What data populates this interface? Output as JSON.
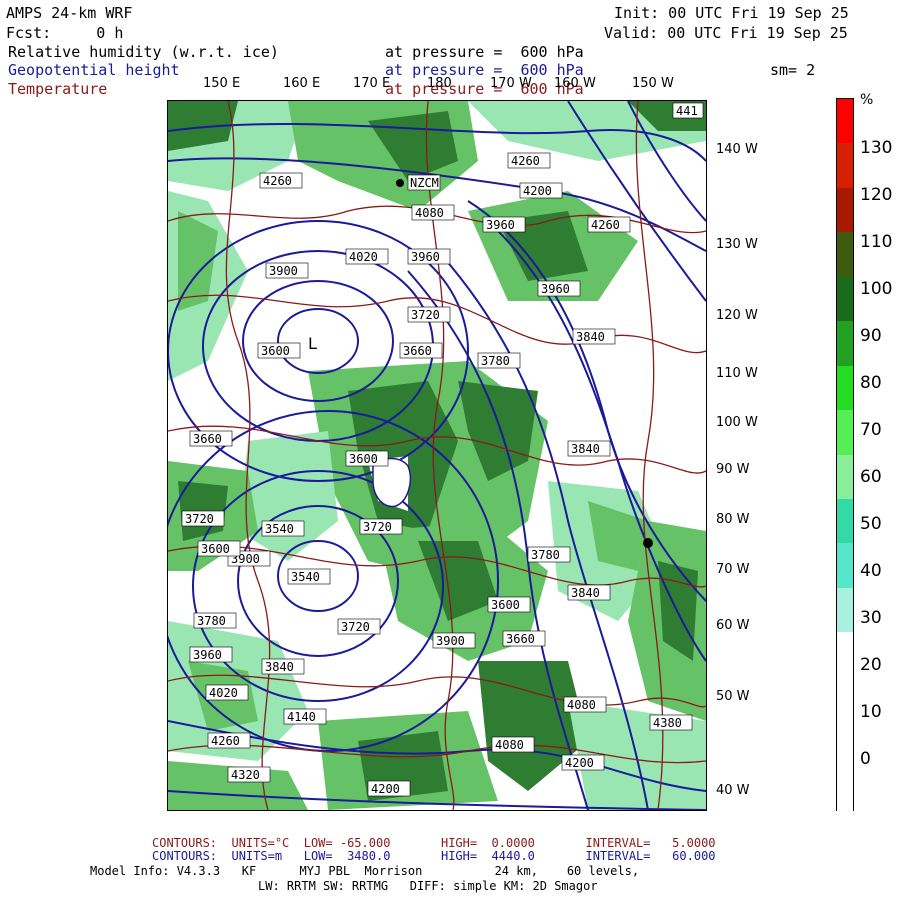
{
  "header": {
    "title": "AMPS 24-km WRF",
    "fcst": "Fcst:     0 h",
    "init": "Init: 00 UTC Fri 19 Sep 25",
    "valid": "Valid: 00 UTC Fri 19 Sep 25",
    "smoothing": "sm= 2"
  },
  "fields": [
    {
      "name": "Relative humidity (w.r.t. ice)",
      "level": "at pressure =  600 hPa",
      "color": "#000000"
    },
    {
      "name": "Geopotential height",
      "level": "at pressure =  600 hPa",
      "color": "#1a1a9a"
    },
    {
      "name": "Temperature",
      "level": "at pressure =  600 hPa",
      "color": "#8a1a1a"
    }
  ],
  "map": {
    "lon_labels": [
      "150 E",
      "160 E",
      "170 E",
      "180",
      "170 W",
      "160 W",
      "150 W"
    ],
    "lat_labels": [
      "140 W",
      "130 W",
      "120 W",
      "110 W",
      "100 W",
      "90 W",
      "80 W",
      "70 W",
      "60 W",
      "50 W",
      "40 W"
    ],
    "corner_label": "441",
    "station_label": "NZCM",
    "contour_labels": [
      "4260",
      "4260",
      "4200",
      "4080",
      "3960",
      "4260",
      "3960",
      "4020",
      "3960",
      "3900",
      "3840",
      "3780",
      "3720",
      "3660",
      "3600",
      "3540",
      "3600",
      "3720",
      "3840",
      "3900",
      "3840",
      "3780",
      "3720",
      "3660",
      "3600",
      "3540",
      "3600",
      "3660",
      "3720",
      "3780",
      "3840",
      "3900",
      "3960",
      "4020",
      "4080",
      "4140",
      "4200",
      "4260",
      "4320",
      "4380",
      "4200",
      "4080"
    ],
    "min_label": "L",
    "colors": {
      "rh_high": "#2e7d32",
      "rh_mid": "#66c266",
      "rh_low": "#99e6b3",
      "geopotential": "#1a1a9a",
      "temperature": "#8a1a1a"
    }
  },
  "colorbar": {
    "unit": "%",
    "labels": [
      "130",
      "120",
      "110",
      "100",
      "90",
      "80",
      "70",
      "60",
      "50",
      "40",
      "30",
      "20",
      "10",
      "0"
    ],
    "colors": [
      "#ff0000",
      "#d62000",
      "#a81a00",
      "#3d5c10",
      "#1a6b1a",
      "#22a022",
      "#22dd22",
      "#55ee55",
      "#88ee99",
      "#33d9a6",
      "#55e6cc",
      "#aaf0e0",
      "#ffffff",
      "#ffffff",
      "#ffffff",
      "#ffffff"
    ]
  },
  "footer": {
    "line1": "CONTOURS:  UNITS=°C  LOW= -65.000       HIGH=  0.0000       INTERVAL=   5.0000",
    "line2": "CONTOURS:  UNITS=m   LOW=  3480.0       HIGH=  4440.0       INTERVAL=   60.000",
    "line3": "Model Info: V4.3.3   KF      MYJ PBL  Morrison          24 km,    60 levels,",
    "line4": "LW: RRTM SW: RRTMG   DIFF: simple KM: 2D Smagor"
  }
}
